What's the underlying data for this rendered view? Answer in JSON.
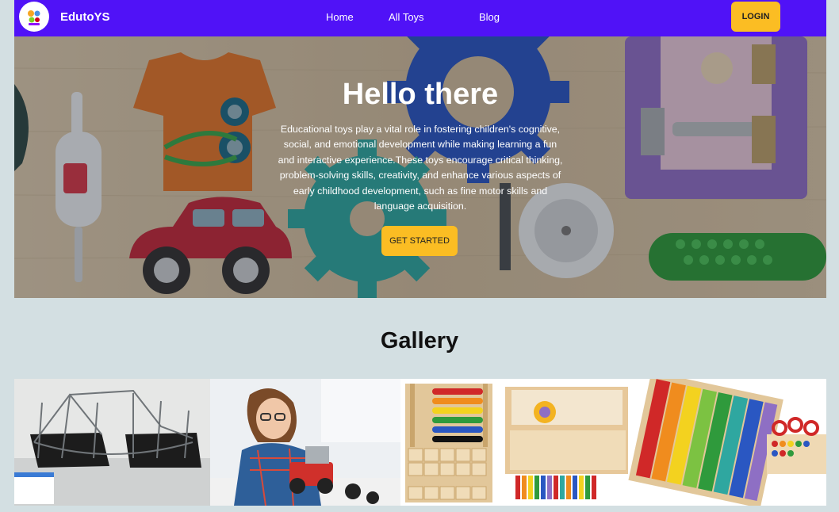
{
  "navbar": {
    "brand": "EdutoYS",
    "links": [
      "Home",
      "All Toys",
      "Blog"
    ],
    "login_label": "LOGIN",
    "background": "#5012f7",
    "accent": "#fbbd23"
  },
  "hero": {
    "title": "Hello there",
    "description": "Educational toys play a vital role in fostering children's cognitive, social, and emotional development while making learning a fun and interactive experience.These toys encourage critical thinking, problem-solving skills, creativity, and enhance various aspects of early childhood development, such as fine motor skills and language acquisition.",
    "cta_label": "GET STARTED"
  },
  "gallery": {
    "title": "Gallery",
    "images": [
      "bridge-construction-kit",
      "girl-building-robot",
      "abacus-and-math-blocks"
    ]
  }
}
